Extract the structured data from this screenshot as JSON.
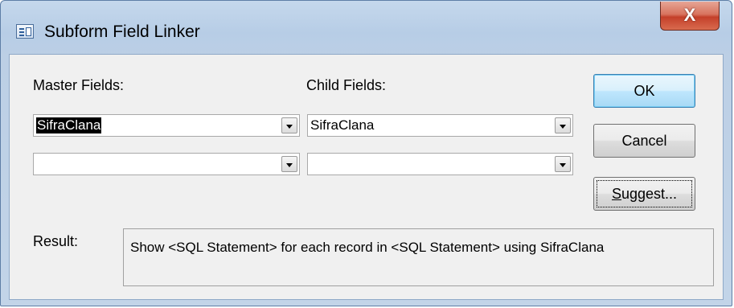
{
  "window": {
    "title": "Subform Field Linker",
    "close_label": "X"
  },
  "master": {
    "label": "Master Fields:",
    "field1_value": "SifraClana",
    "field2_value": ""
  },
  "child": {
    "label": "Child Fields:",
    "field1_value": "SifraClana",
    "field2_value": ""
  },
  "buttons": {
    "ok_label": "OK",
    "cancel_label": "Cancel",
    "suggest_label": "Suggest..."
  },
  "result": {
    "label": "Result:",
    "text": "Show <SQL Statement> for each record in <SQL Statement> using SifraClana"
  }
}
